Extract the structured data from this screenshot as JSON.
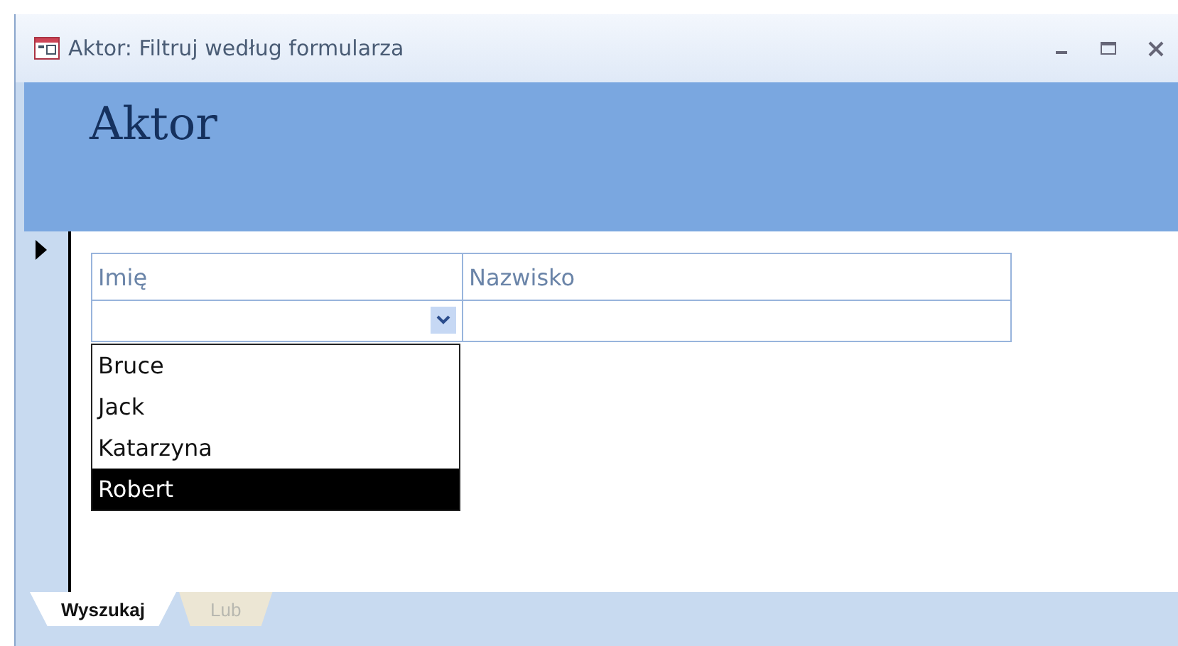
{
  "window": {
    "title": "Aktor: Filtruj według formularza"
  },
  "form": {
    "heading": "Aktor"
  },
  "grid": {
    "columns": [
      "Imię",
      "Nazwisko"
    ]
  },
  "dropdown": {
    "items": [
      {
        "label": "Bruce",
        "selected": false
      },
      {
        "label": "Jack",
        "selected": false
      },
      {
        "label": "Katarzyna",
        "selected": false
      },
      {
        "label": "Robert",
        "selected": true
      }
    ]
  },
  "tabs": [
    {
      "label": "Wyszukaj",
      "selected": true
    },
    {
      "label": "Lub",
      "selected": false
    }
  ]
}
